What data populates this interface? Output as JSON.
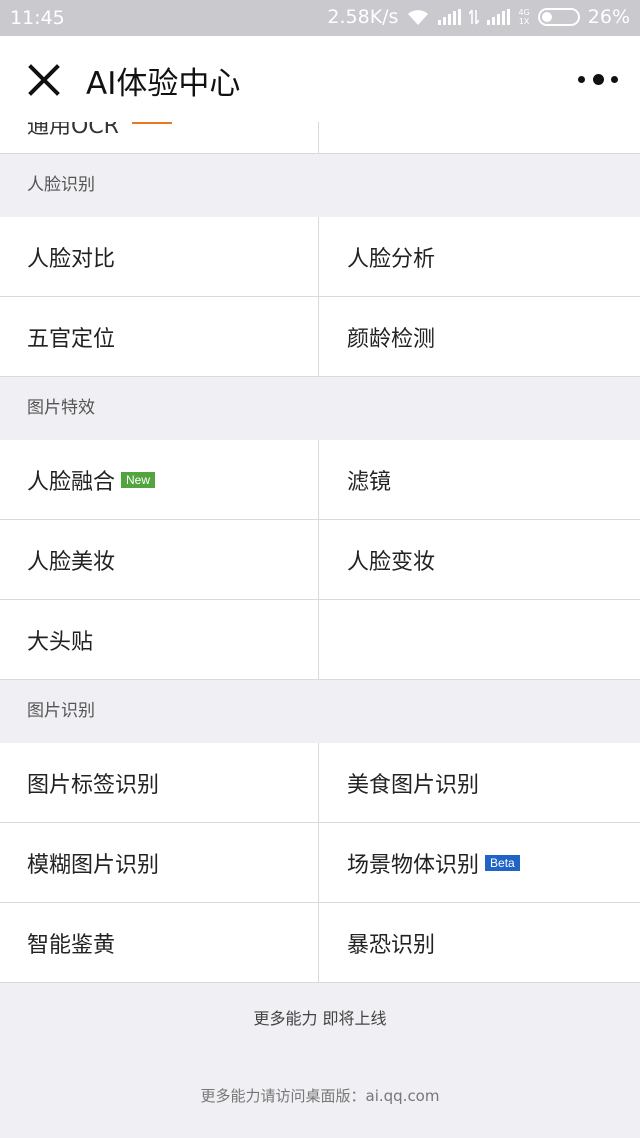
{
  "status_bar": {
    "time": "11:45",
    "speed": "2.58K/s",
    "net_top": "4G",
    "net_bottom": "1X",
    "battery": "26%"
  },
  "nav": {
    "title": "AI体验中心"
  },
  "partial_item": "通用OCR",
  "sections": [
    {
      "header": "人脸识别",
      "items": [
        {
          "label": "人脸对比"
        },
        {
          "label": "人脸分析"
        },
        {
          "label": "五官定位"
        },
        {
          "label": "颜龄检测"
        }
      ]
    },
    {
      "header": "图片特效",
      "items": [
        {
          "label": "人脸融合",
          "badge": "New"
        },
        {
          "label": "滤镜"
        },
        {
          "label": "人脸美妆"
        },
        {
          "label": "人脸变妆"
        },
        {
          "label": "大头贴"
        }
      ]
    },
    {
      "header": "图片识别",
      "items": [
        {
          "label": "图片标签识别"
        },
        {
          "label": "美食图片识别"
        },
        {
          "label": "模糊图片识别"
        },
        {
          "label": "场景物体识别",
          "badge": "Beta"
        },
        {
          "label": "智能鉴黄"
        },
        {
          "label": "暴恐识别"
        }
      ]
    }
  ],
  "footer": {
    "more_coming": "更多能力 即将上线",
    "desktop_hint": "更多能力请访问桌面版：ai.qq.com"
  },
  "colors": {
    "accent_line": "#e8791c",
    "badge_new": "#52a53e",
    "badge_beta": "#2064c8"
  }
}
